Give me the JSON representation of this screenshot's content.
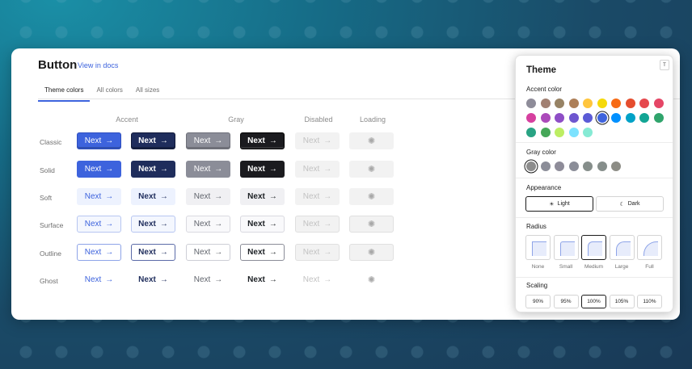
{
  "page": {
    "title": "Button",
    "docs_link": "View in docs",
    "tabs": [
      "Theme colors",
      "All colors",
      "All sizes"
    ],
    "columns": [
      "Accent",
      "Gray",
      "Disabled",
      "Loading"
    ],
    "rows": [
      "Classic",
      "Solid",
      "Soft",
      "Surface",
      "Outline",
      "Ghost"
    ],
    "button_label": "Next",
    "arrow": "→",
    "spinner": "✺"
  },
  "colors": {
    "accent": "#3d63dd",
    "accent_dark": "#1f2d5c",
    "gray": "#8b8d98",
    "gray_dark": "#1b1b1f"
  },
  "panel": {
    "title": "Theme",
    "close_label": "T",
    "accent_label": "Accent color",
    "accent_swatches": [
      "#8e8c99",
      "#a18072",
      "#978365",
      "#ad7f58",
      "#ffc53d",
      "#f5d90a",
      "#f76b15",
      "#e54d2e",
      "#e5484d",
      "#e54666",
      "#d6409f",
      "#ab4aba",
      "#8e4ec6",
      "#6e56cf",
      "#5b5bd6",
      "#3e63dd",
      "#0090ff",
      "#00a2c7",
      "#12a594",
      "#30a46c",
      "#29a383",
      "#46a758",
      "#bdee63",
      "#7ce2fe",
      "#86ead4"
    ],
    "accent_selected_index": 15,
    "gray_label": "Gray color",
    "gray_swatches": [
      "#8d8d8d",
      "#8b8d98",
      "#8e8c99",
      "#8b8d98",
      "#868e8b",
      "#868e8b",
      "#8d8d86"
    ],
    "gray_selected_index": 0,
    "appearance_label": "Appearance",
    "appearance_options": [
      {
        "icon": "☀",
        "label": "Light"
      },
      {
        "icon": "☾",
        "label": "Dark"
      }
    ],
    "radius_label": "Radius",
    "radius_options": [
      "None",
      "Small",
      "Medium",
      "Large",
      "Full"
    ],
    "radius_selected_index": 2,
    "scaling_label": "Scaling",
    "scaling_options": [
      "90%",
      "95%",
      "100%",
      "105%",
      "110%"
    ],
    "scaling_selected_index": 2
  }
}
